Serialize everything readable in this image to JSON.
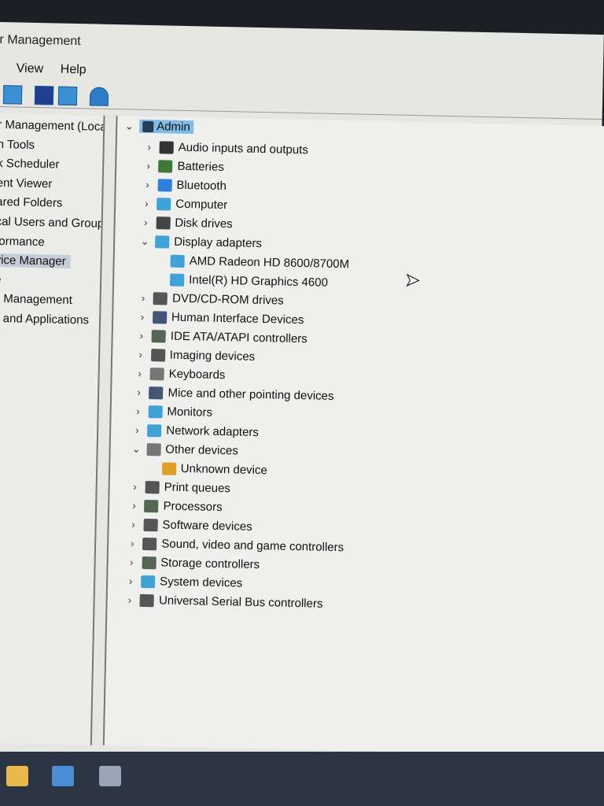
{
  "window": {
    "title": "r Management"
  },
  "menu": [
    "View",
    "Help"
  ],
  "toolbar": [
    "back-forward-icon",
    "help-icon",
    "show-hide-pane-icon",
    "computer-icon"
  ],
  "left_pane": {
    "items": [
      {
        "label": "r Management (Local"
      },
      {
        "label": "n Tools"
      },
      {
        "label": "k Scheduler"
      },
      {
        "label": "ent Viewer"
      },
      {
        "label": "ared Folders"
      },
      {
        "label": "cal Users and Groups"
      },
      {
        "label": "formance"
      },
      {
        "label": "vice Manager",
        "selected": true
      },
      {
        "label": "e"
      },
      {
        "label": "k Management"
      },
      {
        "label": "s and Applications"
      }
    ]
  },
  "device_tree": {
    "root": "Admin",
    "items": [
      {
        "label": "Audio inputs and outputs",
        "expanded": false,
        "icon": "speaker-icon",
        "color": "#333333"
      },
      {
        "label": "Batteries",
        "expanded": false,
        "icon": "battery-icon",
        "color": "#3d7a3a"
      },
      {
        "label": "Bluetooth",
        "expanded": false,
        "icon": "bluetooth-icon",
        "color": "#2f7fe0"
      },
      {
        "label": "Computer",
        "expanded": false,
        "icon": "monitor-icon",
        "color": "#3fa3d8"
      },
      {
        "label": "Disk drives",
        "expanded": false,
        "icon": "disk-icon",
        "color": "#444444"
      },
      {
        "label": "Display adapters",
        "expanded": true,
        "icon": "display-adapter-icon",
        "color": "#3fa3d8",
        "children": [
          "AMD Radeon HD 8600/8700M",
          "Intel(R) HD Graphics 4600"
        ]
      },
      {
        "label": "DVD/CD-ROM drives",
        "expanded": false,
        "icon": "dvd-icon",
        "color": "#555555"
      },
      {
        "label": "Human Interface Devices",
        "expanded": false,
        "icon": "hid-icon",
        "color": "#445577"
      },
      {
        "label": "IDE ATA/ATAPI controllers",
        "expanded": false,
        "icon": "ide-icon",
        "color": "#556655"
      },
      {
        "label": "Imaging devices",
        "expanded": false,
        "icon": "camera-icon",
        "color": "#555555"
      },
      {
        "label": "Keyboards",
        "expanded": false,
        "icon": "keyboard-icon",
        "color": "#777777"
      },
      {
        "label": "Mice and other pointing devices",
        "expanded": false,
        "icon": "mouse-icon",
        "color": "#445577"
      },
      {
        "label": "Monitors",
        "expanded": false,
        "icon": "monitor-icon",
        "color": "#3fa3d8"
      },
      {
        "label": "Network adapters",
        "expanded": false,
        "icon": "network-icon",
        "color": "#3fa3d8"
      },
      {
        "label": "Other devices",
        "expanded": true,
        "icon": "other-device-icon",
        "color": "#777777",
        "children": [
          "Unknown device"
        ]
      },
      {
        "label": "Print queues",
        "expanded": false,
        "icon": "printer-icon",
        "color": "#555555"
      },
      {
        "label": "Processors",
        "expanded": false,
        "icon": "processor-icon",
        "color": "#556655"
      },
      {
        "label": "Software devices",
        "expanded": false,
        "icon": "software-device-icon",
        "color": "#555555"
      },
      {
        "label": "Sound, video and game controllers",
        "expanded": false,
        "icon": "sound-icon",
        "color": "#555555"
      },
      {
        "label": "Storage controllers",
        "expanded": false,
        "icon": "storage-icon",
        "color": "#556655"
      },
      {
        "label": "System devices",
        "expanded": false,
        "icon": "system-icon",
        "color": "#3fa3d8"
      },
      {
        "label": "Universal Serial Bus controllers",
        "expanded": false,
        "icon": "usb-icon",
        "color": "#555555"
      }
    ]
  },
  "taskbar": [
    "file-explorer-icon",
    "store-icon",
    "app-icon"
  ]
}
